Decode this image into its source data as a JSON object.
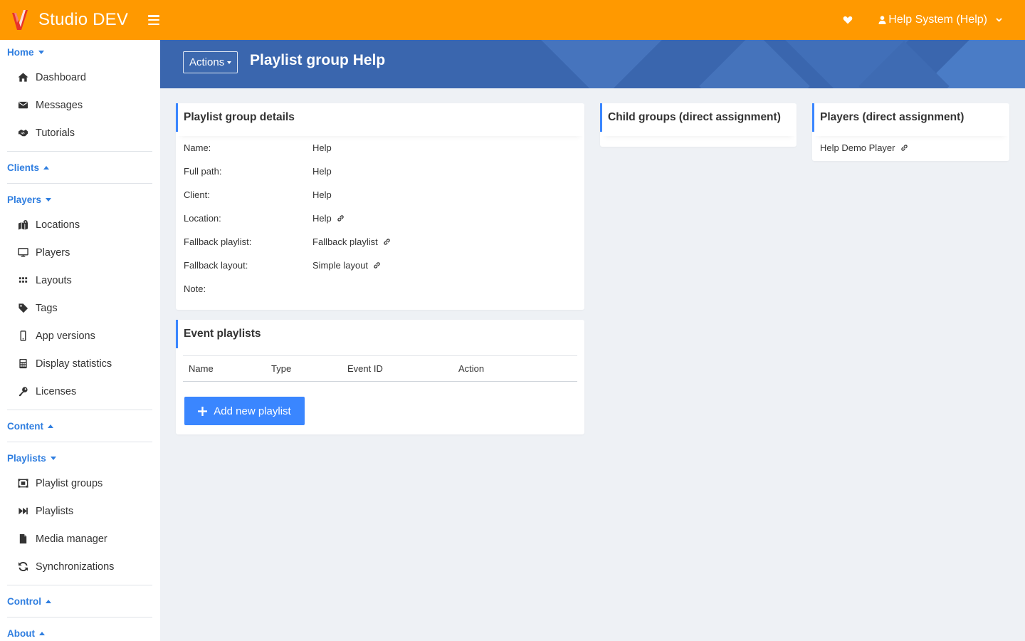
{
  "app": {
    "title": "Studio DEV",
    "accent_color": "#ff9900",
    "primary_color": "#3a86ff"
  },
  "topbar": {
    "menu_icon": "hamburger-icon",
    "favorite_icon": "heart-icon",
    "user_label": "Help System (Help)"
  },
  "sidebar": {
    "sections": {
      "home": {
        "label": "Home",
        "state": "expanded"
      },
      "clients": {
        "label": "Clients",
        "state": "collapsed"
      },
      "players": {
        "label": "Players",
        "state": "expanded"
      },
      "content": {
        "label": "Content",
        "state": "collapsed"
      },
      "playlists": {
        "label": "Playlists",
        "state": "expanded"
      },
      "control": {
        "label": "Control",
        "state": "collapsed"
      },
      "about": {
        "label": "About",
        "state": "collapsed"
      }
    },
    "home_items": [
      {
        "label": "Dashboard",
        "icon": "home-icon"
      },
      {
        "label": "Messages",
        "icon": "envelope-icon"
      },
      {
        "label": "Tutorials",
        "icon": "handshake-icon"
      }
    ],
    "players_items": [
      {
        "label": "Locations",
        "icon": "map-marker-icon"
      },
      {
        "label": "Players",
        "icon": "desktop-icon"
      },
      {
        "label": "Layouts",
        "icon": "grid-icon"
      },
      {
        "label": "Tags",
        "icon": "tag-icon"
      },
      {
        "label": "App versions",
        "icon": "mobile-icon"
      },
      {
        "label": "Display statistics",
        "icon": "calculator-icon"
      },
      {
        "label": "Licenses",
        "icon": "key-icon"
      }
    ],
    "playlists_items": [
      {
        "label": "Playlist groups",
        "icon": "object-group-icon"
      },
      {
        "label": "Playlists",
        "icon": "fast-forward-icon"
      },
      {
        "label": "Media manager",
        "icon": "file-icon"
      },
      {
        "label": "Synchronizations",
        "icon": "sync-icon"
      }
    ]
  },
  "header": {
    "actions_label": "Actions",
    "page_title": "Playlist group Help"
  },
  "details": {
    "title": "Playlist group details",
    "rows": [
      {
        "key": "Name:",
        "value": "Help",
        "link": false
      },
      {
        "key": "Full path:",
        "value": "Help",
        "link": false
      },
      {
        "key": "Client:",
        "value": "Help",
        "link": false
      },
      {
        "key": "Location:",
        "value": "Help",
        "link": true
      },
      {
        "key": "Fallback playlist:",
        "value": "Fallback playlist",
        "link": true
      },
      {
        "key": "Fallback layout:",
        "value": "Simple layout",
        "link": true
      },
      {
        "key": "Note:",
        "value": "",
        "link": false
      }
    ]
  },
  "event_playlists": {
    "title": "Event playlists",
    "columns": [
      "Name",
      "Type",
      "Event ID",
      "Action"
    ],
    "add_label": "Add new playlist"
  },
  "child_groups": {
    "title": "Child groups (direct assignment)"
  },
  "players_card": {
    "title": "Players (direct assignment)",
    "items": [
      {
        "label": "Help Demo Player",
        "link": true
      }
    ]
  }
}
